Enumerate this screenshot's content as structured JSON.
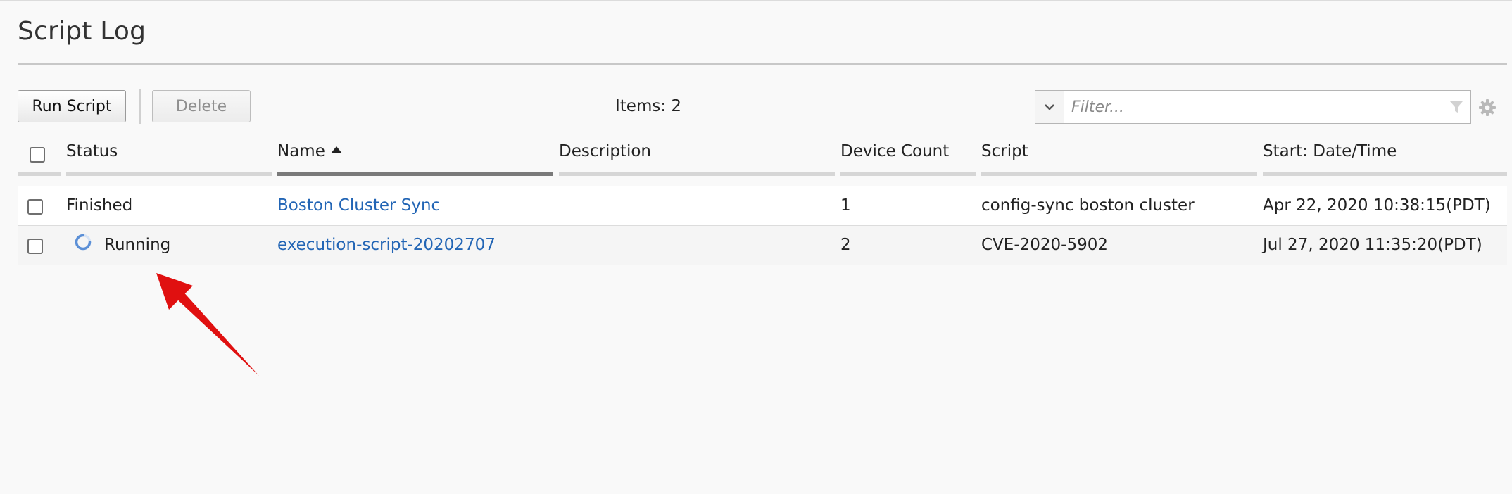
{
  "page": {
    "title": "Script Log"
  },
  "toolbar": {
    "run_label": "Run Script",
    "delete_label": "Delete",
    "items_count": "Items: 2",
    "filter_placeholder": "Filter..."
  },
  "table": {
    "columns": [
      "Status",
      "Name",
      "Description",
      "Device Count",
      "Script",
      "Start: Date/Time"
    ],
    "sorted_column": "Name",
    "rows": [
      {
        "status": "Finished",
        "name": "Boston Cluster Sync",
        "description": "",
        "device_count": "1",
        "script": "config-sync boston cluster",
        "start": "Apr 22, 2020 10:38:15(PDT)"
      },
      {
        "status": "Running",
        "name": "execution-script-20202707",
        "description": "",
        "device_count": "2",
        "script": "CVE-2020-5902",
        "start": "Jul 27, 2020 11:35:20(PDT)"
      }
    ]
  },
  "colors": {
    "link": "#2265b5",
    "spinner": "#5b8fd6",
    "annotation_arrow": "#e01010"
  },
  "icons": {
    "dropdown": "chevron-down-icon",
    "filter": "funnel-icon",
    "settings": "gear-icon",
    "running": "spinner-icon"
  }
}
